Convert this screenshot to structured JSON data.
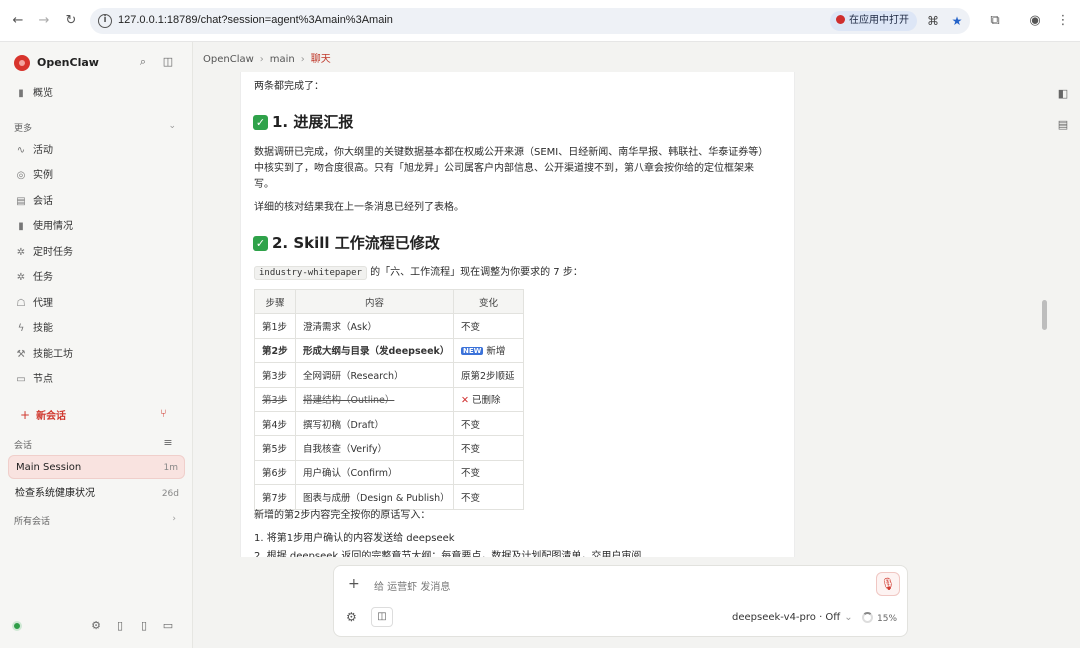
{
  "browser": {
    "url": "127.0.0.1:18789/chat?session=agent%3Amain%3Amain",
    "open_in_app": "在应用中打开"
  },
  "sidebar": {
    "brand": "OpenClaw",
    "overview": "概览",
    "more_label": "更多",
    "items": [
      "活动",
      "实例",
      "会话",
      "使用情况",
      "定时任务",
      "任务",
      "代理",
      "技能",
      "技能工坊",
      "节点"
    ],
    "new_session": "新会话",
    "sessions_label": "会话",
    "sessions": [
      {
        "name": "Main Session",
        "age": "1m"
      },
      {
        "name": "检查系统健康状况",
        "age": "26d"
      }
    ],
    "all_sessions": "所有会话"
  },
  "breadcrumb": {
    "root": "OpenClaw",
    "middle": "main",
    "current": "聊天"
  },
  "message": {
    "intro": "两条都完成了：",
    "heading1": "1. 进展汇报",
    "para1_line1": "数据调研已完成，你大纲里的关键数据基本都在权威公开来源（SEMI、日经新闻、南华早报、韩联社、华泰证券等）",
    "para1_line2": "中核实到了，吻合度很高。只有「旭龙昇」公司属客户内部信息、公开渠道搜不到，第八章会按你给的定位框架来",
    "para1_line3": "写。",
    "para2": "详细的核对结果我在上一条消息已经列了表格。",
    "heading2": "2. Skill 工作流程已修改",
    "skill_code": "industry-whitepaper",
    "skill_text": " 的「六、工作流程」现在调整为你要求的 7 步：",
    "table": {
      "headers": [
        "步骤",
        "内容",
        "变化"
      ],
      "rows": [
        {
          "step": "第1步",
          "content": "澄清需求（Ask）",
          "change": "不变"
        },
        {
          "step": "第2步",
          "content": "形成大纲与目录（发deepseek）",
          "change": "新增",
          "badge": "NEW"
        },
        {
          "step": "第3步",
          "content": "全网调研（Research）",
          "change": "原第2步顺延"
        },
        {
          "step": "第3步",
          "content": "搭建结构（Outline）",
          "change": "已删除"
        },
        {
          "step": "第4步",
          "content": "撰写初稿（Draft）",
          "change": "不变"
        },
        {
          "step": "第5步",
          "content": "自我核查（Verify）",
          "change": "不变"
        },
        {
          "step": "第6步",
          "content": "用户确认（Confirm）",
          "change": "不变"
        },
        {
          "step": "第7步",
          "content": "图表与成册（Design & Publish）",
          "change": "不变"
        }
      ]
    },
    "after_table": "新增的第2步内容完全按你的原话写入：",
    "list1": "1. 将第1步用户确认的内容发送给 deepseek",
    "list2": "2. 根据 deepseek 返回的完整章节大纲：每章要点，数据及计划配图清单，交用户审阅"
  },
  "composer": {
    "placeholder": "给 运营虾 发消息",
    "model": "deepseek-v4-pro · Off",
    "usage": "15%"
  }
}
